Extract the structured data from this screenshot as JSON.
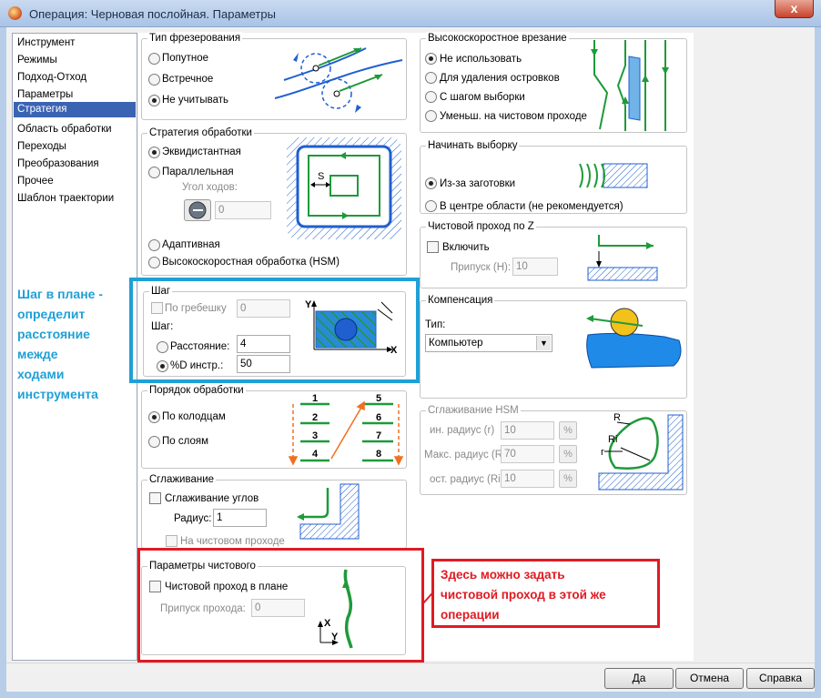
{
  "window": {
    "title": "Операция: Черновая послойная. Параметры",
    "close_glyph": "x"
  },
  "nav": {
    "items": [
      "Инструмент",
      "Режимы",
      "Подход-Отход",
      "Параметры",
      "Стратегия",
      "Область обработки",
      "Переходы",
      "Преобразования",
      "Прочее",
      "Шаблон траектории"
    ],
    "selected": "Стратегия"
  },
  "milling_type": {
    "title": "Тип фрезерования",
    "options": [
      "Попутное",
      "Встречное",
      "Не учитывать"
    ],
    "selected": "Не учитывать"
  },
  "strategy": {
    "title": "Стратегия обработки",
    "options": [
      "Эквидистантная",
      "Параллельная",
      "Адаптивная",
      "Высокоскоростная обработка (HSM)"
    ],
    "selected": "Эквидистантная",
    "angle_label": "Угол ходов:",
    "angle_value": "0",
    "pic_label": "S"
  },
  "step": {
    "title": "Шаг",
    "scallop_label": "По гребешку",
    "scallop_value": "0",
    "step_label": "Шаг:",
    "distance_label": "Расстояние:",
    "distance_value": "4",
    "percent_label": "%D инстр.:",
    "percent_value": "50",
    "selected": "%D инстр.:",
    "axis_y": "Y",
    "axis_x": "X"
  },
  "order": {
    "title": "Порядок обработки",
    "options": [
      "По колодцам",
      "По слоям"
    ],
    "selected": "По колодцам",
    "numbers": [
      "1",
      "2",
      "3",
      "4",
      "5",
      "6",
      "7",
      "8"
    ]
  },
  "smoothing": {
    "title": "Сглаживание",
    "corner_label": "Сглаживание углов",
    "radius_label": "Радиус:",
    "radius_value": "1",
    "finish_label": "На чистовом проходе"
  },
  "finish_params": {
    "title": "Параметры чистового",
    "finish_plane_label": "Чистовой проход в плане",
    "allowance_label": "Припуск прохода:",
    "allowance_value": "0",
    "axis_x": "X",
    "axis_y": "Y"
  },
  "hs_entry": {
    "title": "Высокоскоростное врезание",
    "options": [
      "Не использовать",
      "Для удаления островков",
      "С шагом выборки",
      "Уменьш. на чистовом проходе"
    ],
    "selected": "Не использовать"
  },
  "start_pocket": {
    "title": "Начинать выборку",
    "options": [
      "Из-за заготовки",
      "В центре области (не рекомендуется)"
    ],
    "selected": "Из-за заготовки"
  },
  "finish_z": {
    "title": "Чистовой проход по Z",
    "enable_label": "Включить",
    "allowance_label": "Припуск (H):",
    "allowance_value": "10"
  },
  "compensation": {
    "title": "Компенсация",
    "type_label": "Тип:",
    "type_value": "Компьютер"
  },
  "hsm_smoothing": {
    "title": "Сглаживание HSM",
    "rows": [
      {
        "label": "ин. радиус (r)",
        "value": "10",
        "unit": "%"
      },
      {
        "label": "Макс. радиус (R)",
        "value": "70",
        "unit": "%"
      },
      {
        "label": "ост. радиус (Ri)",
        "value": "10",
        "unit": "%"
      }
    ],
    "pic_R": "R",
    "pic_Ri": "Ri",
    "pic_r": "r"
  },
  "buttons": {
    "ok": "Да",
    "cancel": "Отмена",
    "help": "Справка"
  },
  "annotations": {
    "step_note": "Шаг в плане -\nопределит\nрасстояние\nмежде\nходами\nинструмента",
    "finish_note": "Здесь можно задать\nчистовой проход в этой же\nоперации"
  },
  "colors": {
    "accent": "#3b63b3",
    "annotation_blue": "#1fa0d6",
    "annotation_red": "#e01a22",
    "diagram_green": "#1f9a3a",
    "diagram_blue": "#1f5fd0",
    "diagram_orange": "#f07020"
  }
}
